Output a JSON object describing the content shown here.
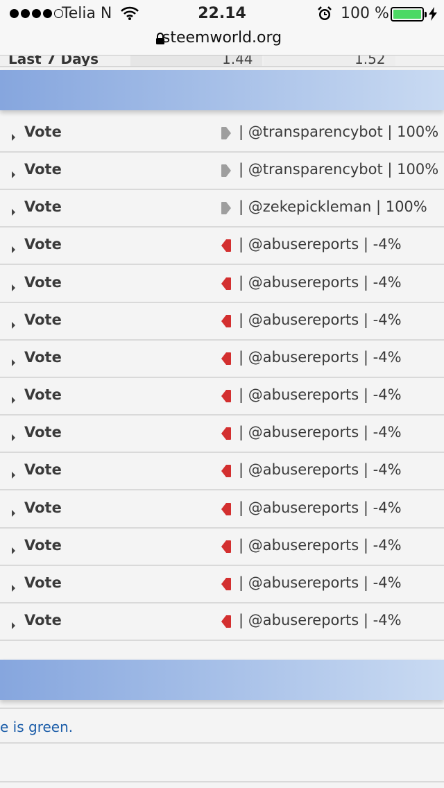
{
  "status_bar": {
    "carrier": "Telia N",
    "time": "22.14",
    "battery_percent": "100 %",
    "battery_color": "#4cd964"
  },
  "url_bar": {
    "url": "steemworld.org",
    "lock_icon": "lock-icon"
  },
  "previous_row": {
    "label": "Last 7 Days",
    "value_1": "1.44",
    "value_2": "1.52"
  },
  "colors": {
    "band_gradient_start": "#86a6de",
    "band_gradient_end": "#c9daf2",
    "upvote_color": "#9e9e9e",
    "downvote_color": "#d32f2f",
    "link_color": "#1a5ca8"
  },
  "votes": [
    {
      "label": "Vote",
      "type": "upvote",
      "detail": "| @transparencybot | 100%"
    },
    {
      "label": "Vote",
      "type": "upvote",
      "detail": "| @transparencybot | 100%"
    },
    {
      "label": "Vote",
      "type": "upvote",
      "detail": "| @zekepickleman | 100%"
    },
    {
      "label": "Vote",
      "type": "downvote",
      "detail": "| @abusereports | -4%"
    },
    {
      "label": "Vote",
      "type": "downvote",
      "detail": "| @abusereports | -4%"
    },
    {
      "label": "Vote",
      "type": "downvote",
      "detail": "| @abusereports | -4%"
    },
    {
      "label": "Vote",
      "type": "downvote",
      "detail": "| @abusereports | -4%"
    },
    {
      "label": "Vote",
      "type": "downvote",
      "detail": "| @abusereports | -4%"
    },
    {
      "label": "Vote",
      "type": "downvote",
      "detail": "| @abusereports | -4%"
    },
    {
      "label": "Vote",
      "type": "downvote",
      "detail": "| @abusereports | -4%"
    },
    {
      "label": "Vote",
      "type": "downvote",
      "detail": "| @abusereports | -4%"
    },
    {
      "label": "Vote",
      "type": "downvote",
      "detail": "| @abusereports | -4%"
    },
    {
      "label": "Vote",
      "type": "downvote",
      "detail": "| @abusereports | -4%"
    },
    {
      "label": "Vote",
      "type": "downvote",
      "detail": "| @abusereports | -4%"
    }
  ],
  "footer_note": "e is green."
}
